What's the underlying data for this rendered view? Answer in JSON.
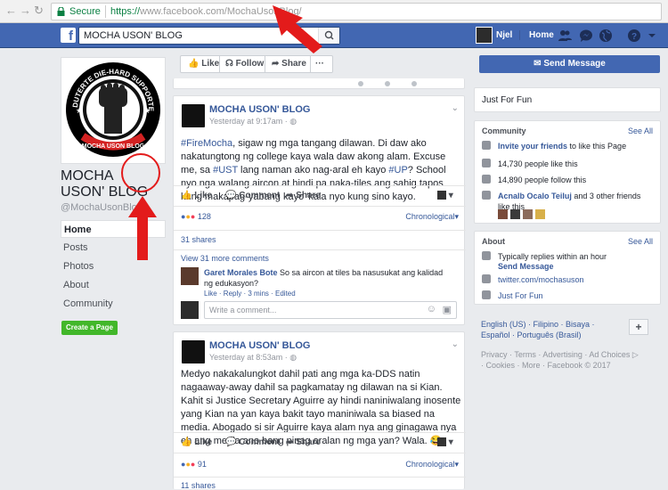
{
  "browser": {
    "secure_label": "Secure",
    "url_scheme": "https://",
    "url_rest": "www.facebook.com/MochaUsonBlog/"
  },
  "fb": {
    "search_value": "MOCHA USON' BLOG",
    "user_name": "Njel",
    "home_label": "Home"
  },
  "page": {
    "name": "MOCHA USON' BLOG",
    "handle": "@MochaUsonBlog",
    "nav": [
      "Home",
      "Posts",
      "Photos",
      "About",
      "Community"
    ],
    "create_page": "Create a Page",
    "logo_ring_text": "DUTERTE DIE-HARD SUPPORTERS",
    "logo_bottom_text": "MOCHA USON BLOG"
  },
  "actions": {
    "like": "Like",
    "follow": "Follow",
    "share": "Share",
    "more": "···"
  },
  "posts": [
    {
      "author": "MOCHA USON' BLOG",
      "time": "Yesterday at 9:17am",
      "text_parts": [
        {
          "t": "#FireMocha",
          "h": true
        },
        {
          "t": ", sigaw ng mga tangang dilawan. Di daw ako nakatungtong ng college kaya wala daw akong alam. Excuse me, sa ",
          "h": false
        },
        {
          "t": "#UST",
          "h": true
        },
        {
          "t": " lang naman ako nag-aral eh kayo ",
          "h": false
        },
        {
          "t": "#UP",
          "h": true
        },
        {
          "t": "? School nyo nga walang aircon at hindi pa naka-tiles ang sahig tapos kung makapag-yabang kayo 'kala nyo kung sino kayo.",
          "h": false
        }
      ],
      "like": "Like",
      "comment": "Comment",
      "share": "Share",
      "reactions": "128",
      "order": "Chronological",
      "shares": "31 shares",
      "view_more": "View 31 more comments",
      "comment_author": "Garet Morales Bote",
      "comment_text": "So sa aircon at tiles ba nasusukat ang kalidad ng edukasyon?",
      "comment_meta": "Like · Reply · 3 mins · Edited",
      "write_placeholder": "Write a comment..."
    },
    {
      "author": "MOCHA USON' BLOG",
      "time": "Yesterday at 8:53am",
      "text": "Medyo nakakalungkot dahil pati ang mga ka-DDS natin nagaaway-away dahil sa pagkamatay ng dilawan na si Kian. Kahit si Justice Secretary Aguirre ay hindi naniniwalang inosente yang Kian na yan kaya bakit tayo maniniwala sa biased na media. Abogado si sir Aguirre kaya alam nya ang ginagawa nya eh ang media ano bang pinag aralan ng mga yan? Wala. 😂",
      "like": "Like",
      "comment": "Comment",
      "share": "Share",
      "reactions": "91",
      "order": "Chronological",
      "shares": "11 shares"
    }
  ],
  "right": {
    "send_message": "Send Message",
    "tagline": "Just For Fun",
    "community": {
      "title": "Community",
      "see_all": "See All",
      "invite_link": "Invite your friends",
      "invite_rest": " to like this Page",
      "likes": "14,730 people like this",
      "follows": "14,890 people follow this",
      "friends_link": "Acnalb Ocalo Teiluj",
      "friends_rest": " and 3 other friends like this"
    },
    "about": {
      "title": "About",
      "see_all": "See All",
      "reply": "Typically replies within an hour",
      "send_message": "Send Message",
      "twitter": "twitter.com/mochasuson",
      "category": "Just For Fun"
    },
    "languages": "English (US) · Filipino · Bisaya · Español · Português (Brasil)",
    "footer": "Privacy · Terms · Advertising · Ad Choices ▷ · Cookies · More · Facebook © 2017"
  },
  "colors": {
    "fb_blue": "#4267b2",
    "link": "#365899",
    "annotation_red": "#e31b1b"
  }
}
